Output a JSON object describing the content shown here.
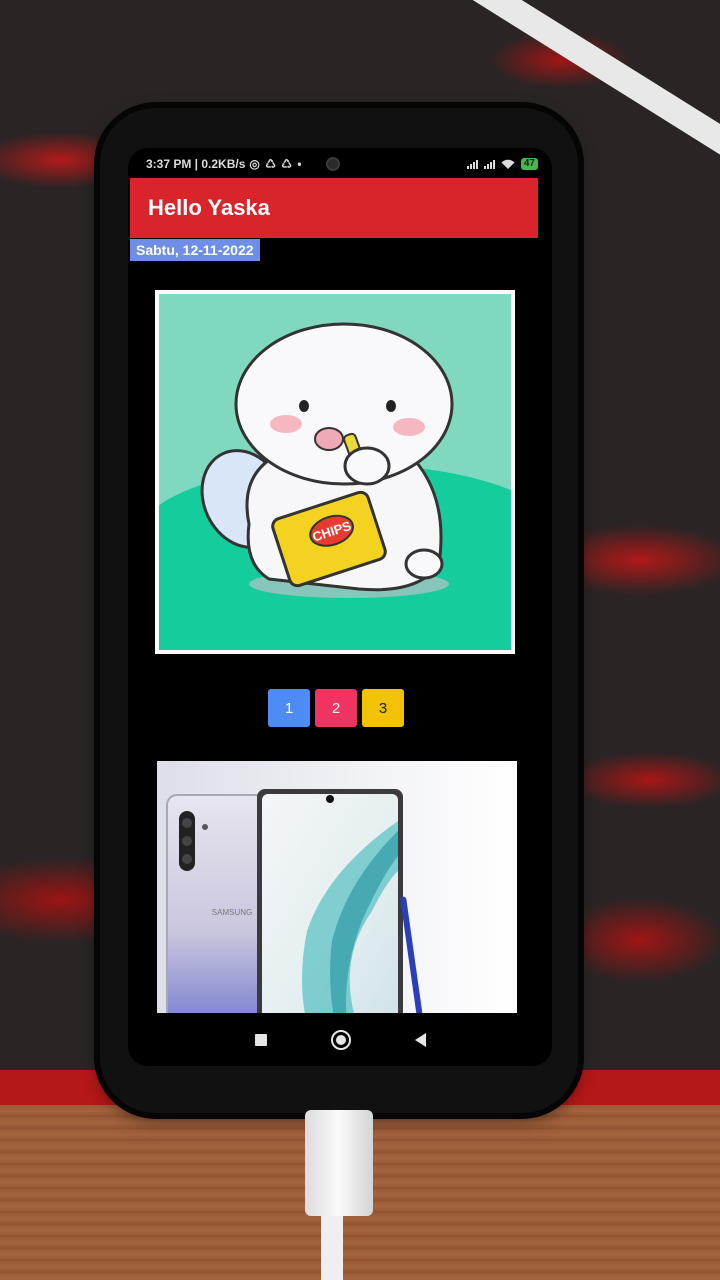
{
  "status_bar": {
    "time": "3:37 PM | 0.2KB/s",
    "status_icons": "◎ ♺ ♺ •",
    "battery": "47"
  },
  "app_bar": {
    "title": "Hello Yaska",
    "date": "Sabtu, 12-11-2022"
  },
  "sticker": {
    "chips_text": "CHIPS"
  },
  "pager": {
    "buttons": [
      "1",
      "2",
      "3"
    ]
  },
  "phone_image": {
    "brand_text": "SAMSUNG"
  },
  "colors": {
    "app_bar": "#d8242a",
    "date_bg": "#6f8fe6",
    "btn_1": "#4d8cf5",
    "btn_2": "#ef3462",
    "btn_3": "#f2c200"
  },
  "icons": [
    "signal-icon",
    "wifi-icon",
    "battery-icon",
    "recents-icon",
    "home-icon",
    "back-icon"
  ]
}
